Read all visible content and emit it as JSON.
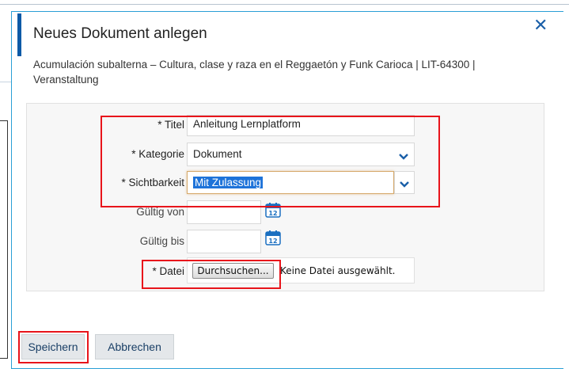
{
  "dialog": {
    "title": "Neues Dokument anlegen",
    "close_icon": "close-icon",
    "subtitle": "Acumulación subalterna – Cultura, clase y raza en el Reggaetón y Funk Carioca | LIT-64300 | Veranstaltung"
  },
  "form": {
    "titel": {
      "label": "* Titel",
      "value": "Anleitung Lernplatform"
    },
    "kategorie": {
      "label": "* Kategorie",
      "value": "Dokument"
    },
    "sichtbarkeit": {
      "label": "* Sichtbarkeit",
      "value": "Mit Zulassung"
    },
    "gueltig_von": {
      "label": "Gültig von",
      "value": ""
    },
    "gueltig_bis": {
      "label": "Gültig bis",
      "value": ""
    },
    "datei": {
      "label": "* Datei",
      "browse_label": "Durchsuchen...",
      "status": "Keine Datei ausgewählt."
    },
    "calendar_icon_text": "12"
  },
  "buttons": {
    "save": "Speichern",
    "cancel": "Abbrechen"
  },
  "colors": {
    "accent": "#0d5aa7",
    "highlight_border": "#e8141b",
    "link": "#1a5fa8"
  }
}
